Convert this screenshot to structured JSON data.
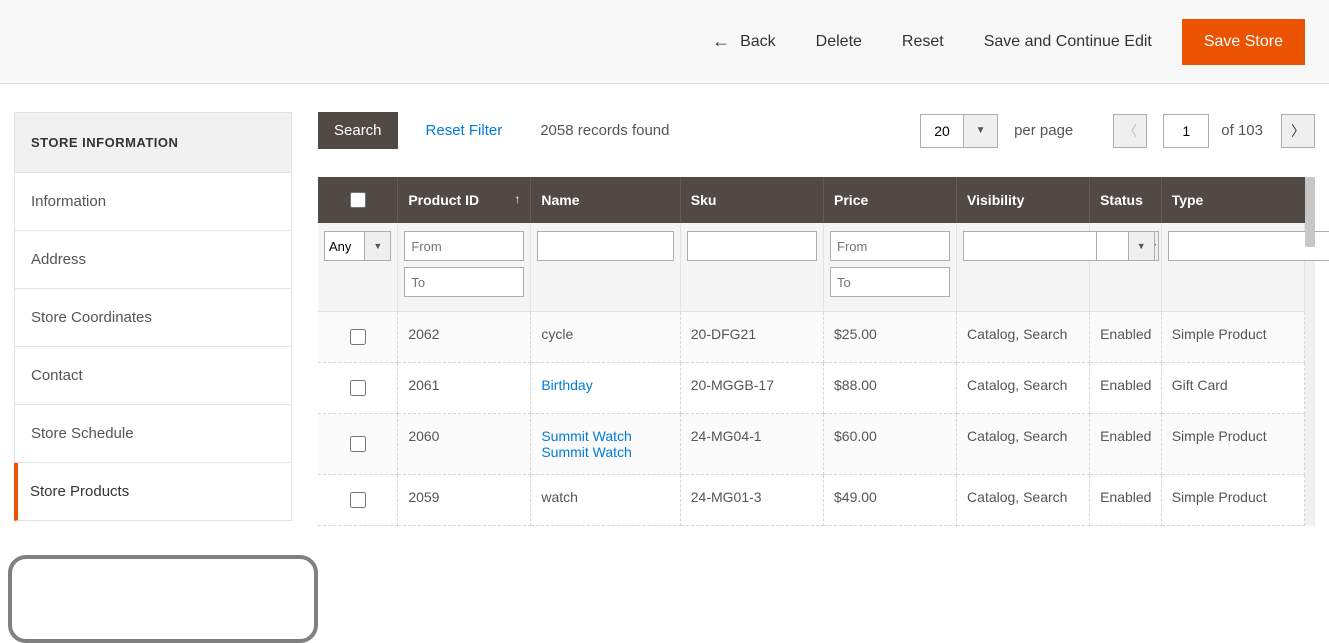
{
  "topbar": {
    "back": "Back",
    "delete": "Delete",
    "reset": "Reset",
    "save_continue": "Save and Continue Edit",
    "save_store": "Save Store"
  },
  "sidebar": {
    "title": "STORE INFORMATION",
    "items": [
      {
        "label": "Information"
      },
      {
        "label": "Address"
      },
      {
        "label": "Store Coordinates"
      },
      {
        "label": "Contact"
      },
      {
        "label": "Store Schedule"
      },
      {
        "label": "Store Products"
      }
    ]
  },
  "controls": {
    "search": "Search",
    "reset_filter": "Reset Filter",
    "records_found": "2058 records found",
    "per_page_value": "20",
    "per_page_label": "per page",
    "page_value": "1",
    "of_label": "of 103"
  },
  "grid": {
    "headers": {
      "product_id": "Product ID",
      "name": "Name",
      "sku": "Sku",
      "price": "Price",
      "visibility": "Visibility",
      "status": "Status",
      "type": "Type"
    },
    "filters": {
      "any": "Any",
      "from": "From",
      "to": "To"
    },
    "rows": [
      {
        "pid": "2062",
        "name": "cycle",
        "sku": "20-DFG21",
        "price": "$25.00",
        "visibility": "Catalog, Search",
        "status": "Enabled",
        "type": "Simple Product",
        "name_link": false
      },
      {
        "pid": "2061",
        "name": "Birthday",
        "sku": "20-MGGB-17",
        "price": "$88.00",
        "visibility": "Catalog, Search",
        "status": "Enabled",
        "type": "Gift Card",
        "name_link": true
      },
      {
        "pid": "2060",
        "name": "Summit Watch Summit Watch",
        "sku": "24-MG04-1",
        "price": "$60.00",
        "visibility": "Catalog, Search",
        "status": "Enabled",
        "type": "Simple Product",
        "name_link": true
      },
      {
        "pid": "2059",
        "name": "watch",
        "sku": "24-MG01-3",
        "price": "$49.00",
        "visibility": "Catalog, Search",
        "status": "Enabled",
        "type": "Simple Product",
        "name_link": false
      }
    ]
  }
}
